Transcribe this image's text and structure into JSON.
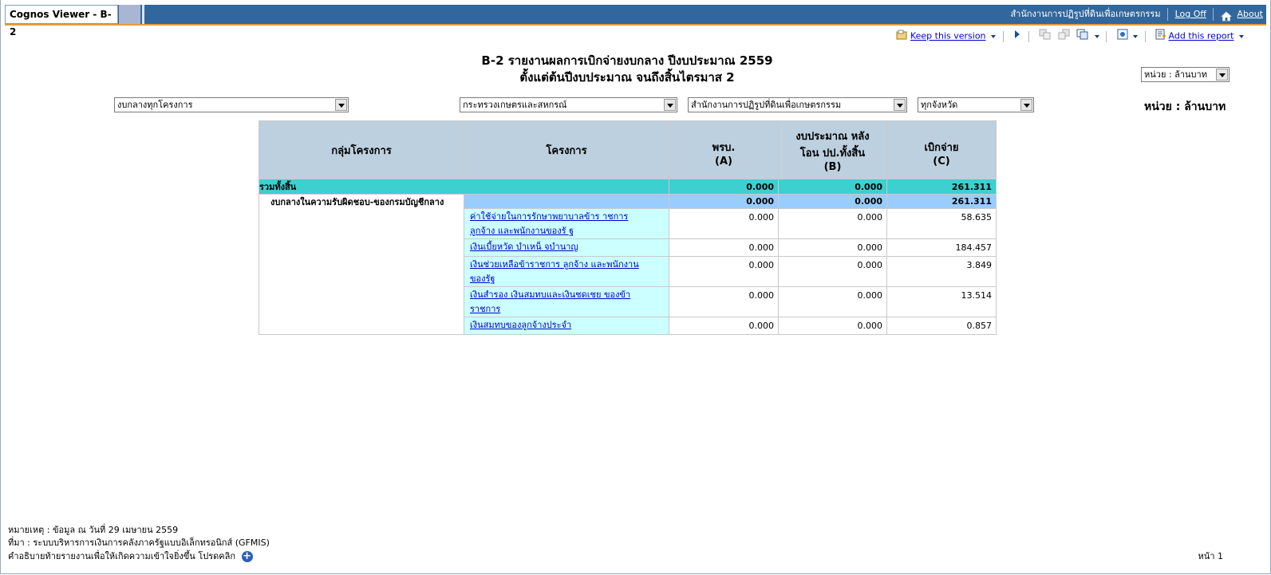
{
  "header": {
    "app_title": "Cognos Viewer - B-2",
    "org_name": "สำนักงานการปฏิรูปที่ดินเพื่อเกษตรกรรม",
    "log_off": "Log Off",
    "about": "About"
  },
  "toolbar": {
    "keep_version": "Keep this version",
    "add_report": "Add this report"
  },
  "report": {
    "title_line1": "B-2 รายงานผลการเบิกจ่ายงบกลาง ปีงบประมาณ 2559",
    "title_line2": "ตั้งแต่ต้นปีงบประมาณ จนถึงสิ้นไตรมาส 2",
    "unit_select": "หน่วย : ล้านบาท",
    "unit_label": "หน่วย : ล้านบาท"
  },
  "filters": {
    "project_group": "งบกลางทุกโครงการ",
    "ministry": "กระทรวงเกษตรและสหกรณ์",
    "department": "สำนักงานการปฏิรูปที่ดินเพื่อเกษตรกรรม",
    "province": "ทุกจังหวัด"
  },
  "table": {
    "headers": {
      "group": "กลุ่มโครงการ",
      "project": "โครงการ",
      "budget_a_1": "พรบ.",
      "budget_a_2": "(A)",
      "budget_b_1": "งบประมาณ หลัง",
      "budget_b_2": "โอน ปป.ทั้งสิ้น",
      "budget_b_3": "(B)",
      "disb_c_1": "เบิกจ่าย",
      "disb_c_2": "(C)"
    },
    "total": {
      "label": "รวมทั้งสิ้น",
      "a": "0.000",
      "b": "0.000",
      "c": "261.311"
    },
    "group": {
      "label": "งบกลางในความรับผิดชอบ-ของกรมบัญชีกลาง",
      "a": "0.000",
      "b": "0.000",
      "c": "261.311"
    },
    "rows": [
      {
        "line1": "ค่าใช้จ่ายในการรักษาพยาบาลข้าร าชการ",
        "line2": "ลูกจ้าง และพนักงานของรั ฐ",
        "a": "0.000",
        "b": "0.000",
        "c": "58.635"
      },
      {
        "line1": "เงินเบี้ยหวัด บำเหน็ จบำนาญ",
        "line2": "",
        "a": "0.000",
        "b": "0.000",
        "c": "184.457"
      },
      {
        "line1": "เงินช่วยเหลือข้าราชการ ลูกจ้าง และพนักงาน",
        "line2": "ของรัฐ",
        "a": "0.000",
        "b": "0.000",
        "c": "3.849"
      },
      {
        "line1": "เงินสำรอง เงินสมทบและเงินชดเชย ของข้า",
        "line2": "ราชการ",
        "a": "0.000",
        "b": "0.000",
        "c": "13.514"
      },
      {
        "line1": "เงินสมทบของลูกจ้างประจำ",
        "line2": "",
        "a": "0.000",
        "b": "0.000",
        "c": "0.857"
      }
    ]
  },
  "footer": {
    "note": "หมายเหตุ : ข้อมูล ณ วันที่ 29 เมษายน 2559",
    "source": "ที่มา : ระบบบริหารการเงินการคลังภาครัฐแบบอิเล็กทรอนิกส์ (GFMIS)",
    "explain": "คำอธิบายท้ายรายงานเพื่อให้เกิดความเข้าใจยิ่งขึ้น โปรดคลิก",
    "page": "หน้า 1"
  }
}
